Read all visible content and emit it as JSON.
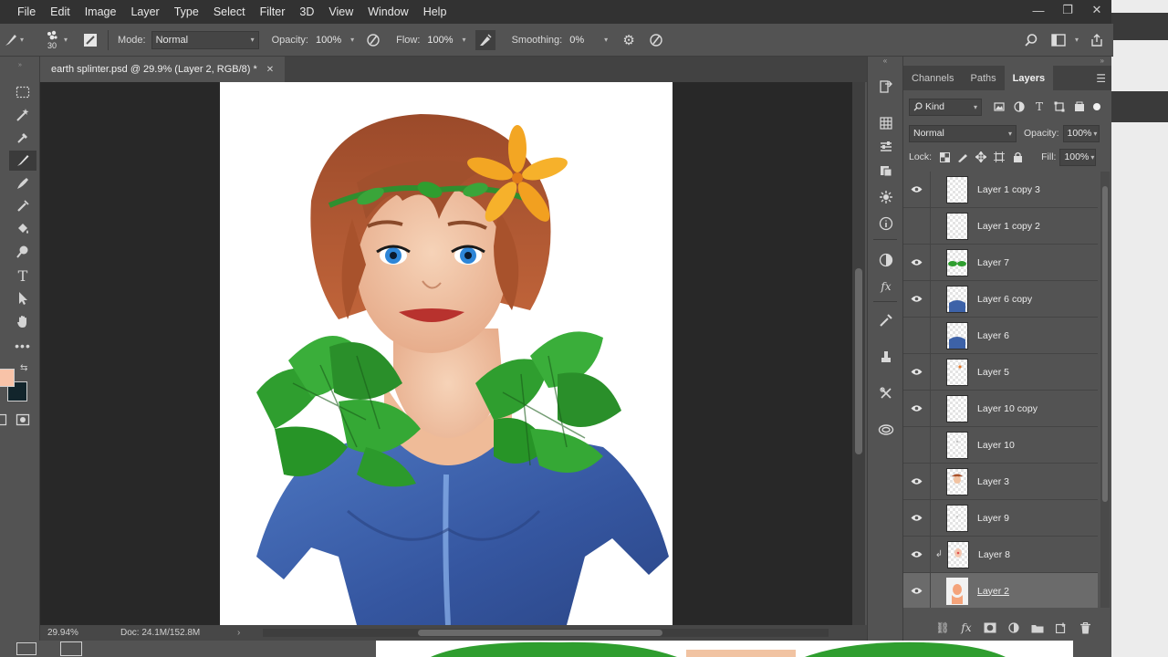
{
  "menu": [
    "File",
    "Edit",
    "Image",
    "Layer",
    "Type",
    "Select",
    "Filter",
    "3D",
    "View",
    "Window",
    "Help"
  ],
  "window_controls": {
    "minimize": "—",
    "restore": "❐",
    "close": "✕"
  },
  "options": {
    "brush_size": "30",
    "mode_label": "Mode:",
    "mode_value": "Normal",
    "opacity_label": "Opacity:",
    "opacity_value": "100%",
    "flow_label": "Flow:",
    "flow_value": "100%",
    "smoothing_label": "Smoothing:",
    "smoothing_value": "0%"
  },
  "document": {
    "tab_title": "earth splinter.psd @ 29.9% (Layer 2, RGB/8) *",
    "zoom": "29.94%",
    "doc_size": "Doc: 24.1M/152.8M"
  },
  "colors": {
    "foreground": "#f8c3a8",
    "background": "#12252c",
    "hair": "#a8512a",
    "leaves": "#2f9e2f",
    "dress": "#3d62a8",
    "skin": "#f1c3a2",
    "flower": "#f3a623"
  },
  "layers_panel": {
    "tabs": [
      "Channels",
      "Paths",
      "Layers"
    ],
    "active_tab": "Layers",
    "filter_label": "Kind",
    "blend_mode": "Normal",
    "opacity_label": "Opacity:",
    "opacity_value": "100%",
    "lock_label": "Lock:",
    "fill_label": "Fill:",
    "fill_value": "100%",
    "layers": [
      {
        "name": "Layer 1 copy 3",
        "visible": true,
        "clipped": false,
        "selected": false
      },
      {
        "name": "Layer 1 copy 2",
        "visible": false,
        "clipped": false,
        "selected": false
      },
      {
        "name": "Layer 7",
        "visible": true,
        "clipped": false,
        "selected": false
      },
      {
        "name": "Layer 6 copy",
        "visible": true,
        "clipped": false,
        "selected": false
      },
      {
        "name": "Layer 6",
        "visible": false,
        "clipped": false,
        "selected": false
      },
      {
        "name": "Layer 5",
        "visible": true,
        "clipped": false,
        "selected": false
      },
      {
        "name": "Layer 10 copy",
        "visible": true,
        "clipped": false,
        "selected": false
      },
      {
        "name": "Layer 10",
        "visible": false,
        "clipped": false,
        "selected": false
      },
      {
        "name": "Layer 3",
        "visible": true,
        "clipped": false,
        "selected": false
      },
      {
        "name": "Layer 9",
        "visible": true,
        "clipped": false,
        "selected": false
      },
      {
        "name": "Layer 8",
        "visible": true,
        "clipped": true,
        "selected": false
      },
      {
        "name": "Layer 2",
        "visible": true,
        "clipped": false,
        "selected": true
      }
    ]
  }
}
